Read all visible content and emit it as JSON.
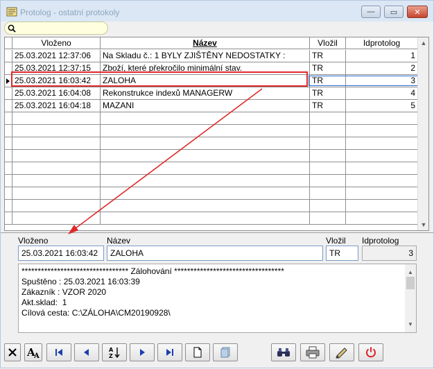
{
  "window": {
    "title": "Protolog - ostatní protokoly",
    "minimize_glyph": "—",
    "maximize_glyph": "▭",
    "close_glyph": "✕"
  },
  "search": {
    "value": "",
    "icon": "search-icon"
  },
  "grid": {
    "columns": [
      "Vloženo",
      "Název",
      "Vložil",
      "Idprotolog"
    ],
    "rows": [
      {
        "vlozeno": "25.03.2021 12:37:06",
        "nazev": "Na Skladu č.: 1 BYLY ZJIŠTĚNY NEDOSTATKY :",
        "vlozil": "TR",
        "id": "1"
      },
      {
        "vlozeno": "25.03.2021 12:37:15",
        "nazev": "Zboží, které překročilo minimální stav.",
        "vlozil": "TR",
        "id": "2"
      },
      {
        "vlozeno": "25.03.2021 16:03:42",
        "nazev": "ZALOHA",
        "vlozil": "TR",
        "id": "3"
      },
      {
        "vlozeno": "25.03.2021 16:04:08",
        "nazev": "Rekonstrukce indexů MANAGERW",
        "vlozil": "TR",
        "id": "4"
      },
      {
        "vlozeno": "25.03.2021 16:04:18",
        "nazev": "MAZANI",
        "vlozil": "TR",
        "id": "5"
      }
    ],
    "selected_row_index": 2
  },
  "detail": {
    "label_vlozeno": "Vloženo",
    "label_nazev": "Název",
    "label_vlozil": "Vložil",
    "label_id": "Idprotolog",
    "vlozeno": "25.03.2021 16:03:42",
    "nazev": "ZALOHA",
    "vlozil": "TR",
    "id": "3"
  },
  "memo": {
    "lines": [
      "********************************* Zálohování **********************************",
      "Spuštěno : 25.03.2021 16:03:39",
      "Zákazník : VZOR 2020",
      "Akt.sklad:  1",
      "Cílová cesta: C:\\ZÁLOHA\\CM20190928\\"
    ]
  },
  "toolbar": {
    "buttons": [
      "close-x-icon",
      "font-icon",
      "first-record-icon",
      "previous-record-icon",
      "sort-az-icon",
      "next-record-icon",
      "last-record-icon",
      "new-document-icon",
      "copy-document-icon",
      "find-icon",
      "print-icon",
      "edit-icon",
      "power-icon"
    ]
  },
  "colors": {
    "annotation": "#e0282b",
    "selection": "#2a6ad0",
    "search_bg": "#ffffe0"
  }
}
